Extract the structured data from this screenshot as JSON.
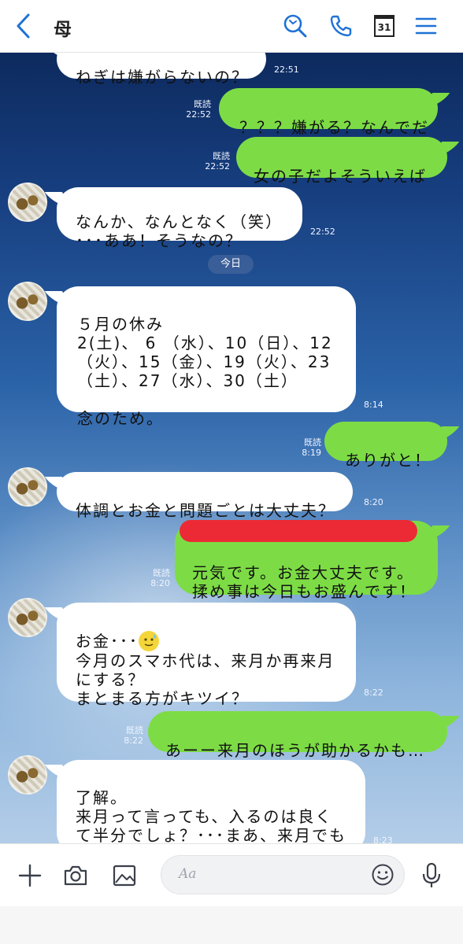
{
  "header": {
    "title": "母",
    "calendar_day": "31",
    "icons": [
      "back-chevron-icon",
      "search-icon",
      "phone-icon",
      "calendar-icon",
      "menu-icon"
    ],
    "accent_color": "#1f72d6"
  },
  "chat": {
    "date_divider": "今日",
    "messages": [
      {
        "id": "m1",
        "side": "in",
        "text": "ねぎは嫌がらないの？",
        "time": "22:51"
      },
      {
        "id": "m2",
        "side": "out",
        "text": "？？？嫌がる？なんでだ",
        "read": "既読",
        "time": "22:52"
      },
      {
        "id": "m3",
        "side": "out",
        "text": "女の子だよそういえば",
        "read": "既読",
        "time": "22:52"
      },
      {
        "id": "m4",
        "side": "in",
        "text": "なんか、なんとなく（笑）\n･･･ああ！そうなの？",
        "time": "22:52"
      },
      {
        "id": "m5",
        "side": "in",
        "text": "５月の休み\n2(土)、 6 （水）、10（日）、12\n（火）、15（金）、19（火）、23\n（土）、27（水）、30（土）\n\n念のため。",
        "time": "8:14"
      },
      {
        "id": "m6",
        "side": "out",
        "text": "ありがと！",
        "read": "既読",
        "time": "8:19"
      },
      {
        "id": "m7",
        "side": "in",
        "text": "体調とお金と問題ごとは大丈夫？",
        "time": "8:20"
      },
      {
        "id": "m8",
        "side": "out",
        "text": "元気です。お金大丈夫です。\n揉め事は今日もお盛んです！",
        "read": "既読",
        "time": "8:20"
      },
      {
        "id": "m9",
        "side": "in",
        "text_before_emoji": "お金･･･",
        "text_after_emoji": "\n今月のスマホ代は、来月か再来月\nにする？\nまとまる方がキツイ？",
        "time": "8:22"
      },
      {
        "id": "m10",
        "side": "out",
        "text": "あーー来月のほうが助かるかも…",
        "read": "既読",
        "time": "8:22"
      },
      {
        "id": "m11",
        "side": "in",
        "text": "了解。\n来月って言っても、入るのは良く\nて半分でしょ？･･･まあ、来月でも\n再来月でも。",
        "time": "8:23"
      }
    ],
    "colors": {
      "outgoing": "#7ddc45",
      "incoming": "#ffffff",
      "redaction": "#ec2a35"
    }
  },
  "input": {
    "placeholder": "Aa",
    "icons": [
      "plus-icon",
      "camera-icon",
      "image-icon",
      "emoji-icon",
      "microphone-icon"
    ]
  }
}
